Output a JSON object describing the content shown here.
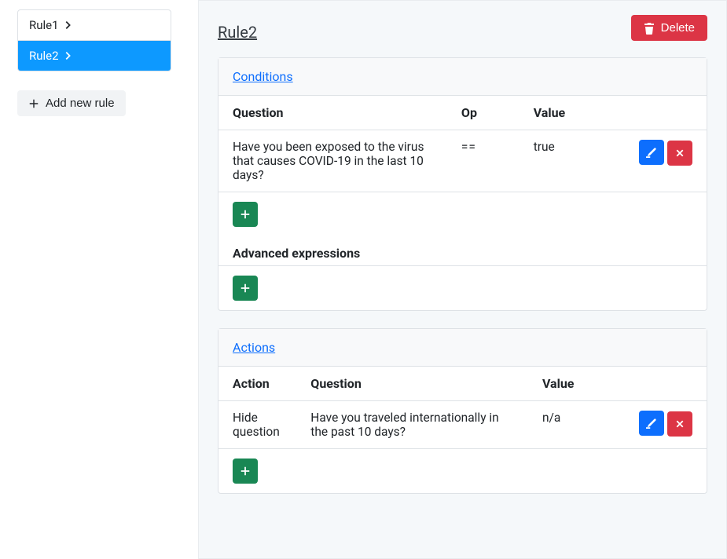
{
  "sidebar": {
    "rules": [
      {
        "label": "Rule1",
        "active": false
      },
      {
        "label": "Rule2",
        "active": true
      }
    ],
    "addRuleLabel": "Add new rule"
  },
  "main": {
    "title": "Rule2",
    "deleteLabel": "Delete"
  },
  "conditions": {
    "header": "Conditions",
    "columns": {
      "question": "Question",
      "op": "Op",
      "value": "Value"
    },
    "rows": [
      {
        "question": "Have you been exposed to the virus that causes COVID-19 in the last 10 days?",
        "op": "==",
        "value": "true"
      }
    ],
    "advancedLabel": "Advanced expressions"
  },
  "actions": {
    "header": "Actions",
    "columns": {
      "action": "Action",
      "question": "Question",
      "value": "Value"
    },
    "rows": [
      {
        "action": "Hide question",
        "question": "Have you traveled internationally in the past 10 days?",
        "value": "n/a"
      }
    ]
  }
}
